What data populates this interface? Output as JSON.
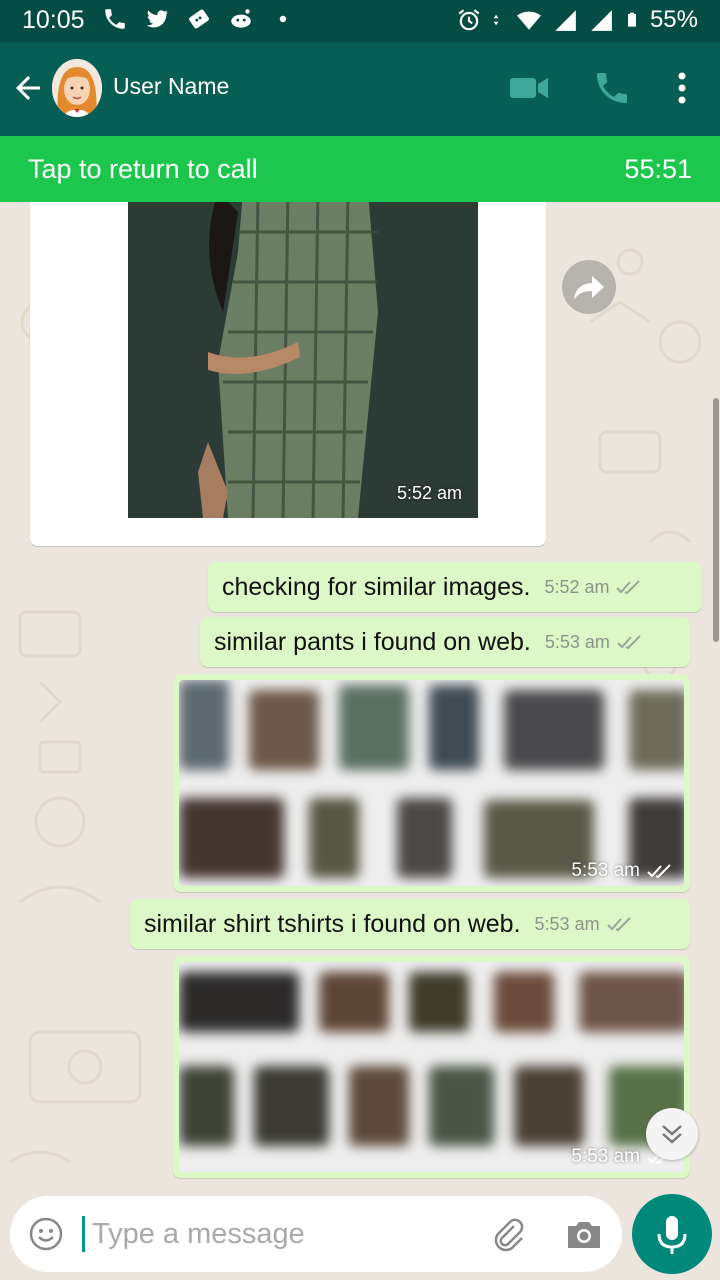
{
  "status_bar": {
    "time": "10:05",
    "battery": "55%"
  },
  "header": {
    "contact_name": "User Name"
  },
  "call_banner": {
    "label": "Tap to return to call",
    "duration": "55:51"
  },
  "messages": [
    {
      "type": "image",
      "direction": "in",
      "time": "5:52 am"
    },
    {
      "type": "text",
      "direction": "out",
      "text": "checking for similar images.",
      "time": "5:52 am",
      "status": "read"
    },
    {
      "type": "text",
      "direction": "out",
      "text": "similar pants i found on web.",
      "time": "5:53 am",
      "status": "read"
    },
    {
      "type": "image",
      "direction": "out",
      "time": "5:53 am",
      "status": "read"
    },
    {
      "type": "text",
      "direction": "out",
      "text": "similar shirt tshirts i found on web.",
      "time": "5:53 am",
      "status": "read"
    },
    {
      "type": "image",
      "direction": "out",
      "time": "5:53 am",
      "status": "read"
    }
  ],
  "composer": {
    "placeholder": "Type a message"
  },
  "colors": {
    "header": "#075e54",
    "status_bar": "#054d44",
    "call_banner": "#1dc74e",
    "outgoing_bubble": "#dcf8c6",
    "accent": "#00897b"
  }
}
